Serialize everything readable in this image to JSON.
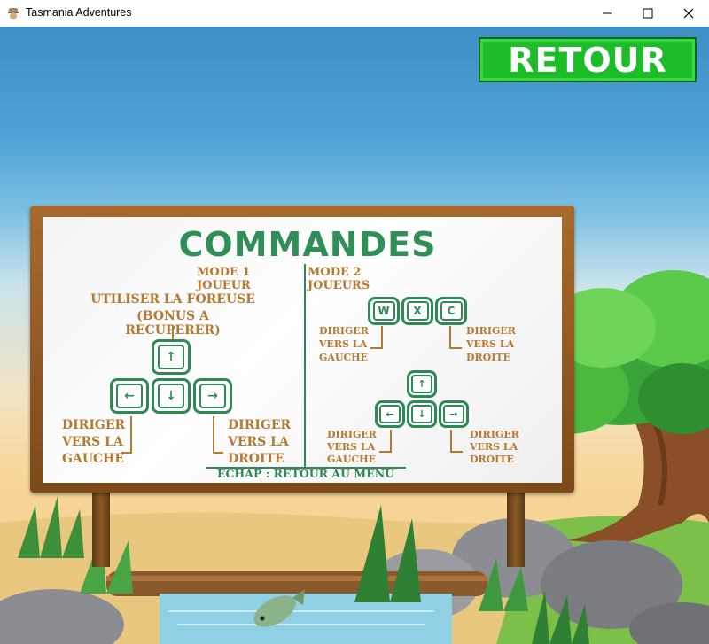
{
  "window": {
    "title": "Tasmania Adventures"
  },
  "buttons": {
    "retour": "RETOUR"
  },
  "board": {
    "title": "COMMANDES",
    "mode1": "MODE 1 JOUEUR",
    "mode2": "MODE 2 JOUEURS",
    "foreuse_line1": "UTILISER LA FOREUSE",
    "foreuse_line2": "(BONUS A RECUPERER)",
    "left_l1": "DIRIGER",
    "left_l2": "VERS LA",
    "left_l3": "GAUCHE",
    "right_l1": "DIRIGER",
    "right_l2": "VERS LA",
    "right_l3": "DROITE",
    "key_w": "W",
    "key_x": "X",
    "key_c": "C",
    "arrow_up": "↑",
    "arrow_down": "↓",
    "arrow_left": "←",
    "arrow_right": "→",
    "footer": "ECHAP : RETOUR AU MENU"
  }
}
